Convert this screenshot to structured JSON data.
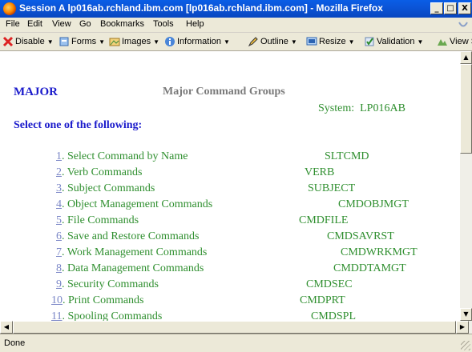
{
  "window": {
    "title": "Session A lp016ab.rchland.ibm.com [lp016ab.rchland.ibm.com] - Mozilla Firefox",
    "minimize": "_",
    "maximize": "□",
    "close": "X"
  },
  "menu": {
    "file": "File",
    "edit": "Edit",
    "view": "View",
    "go": "Go",
    "bookmarks": "Bookmarks",
    "tools": "Tools",
    "help": "Help"
  },
  "toolbar": {
    "disable": "Disable",
    "forms": "Forms",
    "images": "Images",
    "information": "Information",
    "outline": "Outline",
    "resize": "Resize",
    "validation": "Validation",
    "view_source": "View S"
  },
  "page": {
    "panel_id": "MAJOR",
    "panel_title": "Major Command Groups",
    "system_label": "System:",
    "system_name": "LP016AB",
    "prompt": "Select one of the following:",
    "options": [
      {
        "num": "1",
        "label": ". Select Command by Name",
        "command": "SLTCMD"
      },
      {
        "num": "2",
        "label": ". Verb Commands",
        "command": "VERB"
      },
      {
        "num": "3",
        "label": ". Subject Commands",
        "command": "SUBJECT"
      },
      {
        "num": "4",
        "label": ". Object Management Commands",
        "command": "CMDOBJMGT"
      },
      {
        "num": "5",
        "label": ". File Commands",
        "command": "CMDFILE"
      },
      {
        "num": "6",
        "label": ". Save and Restore Commands",
        "command": "CMDSAVRST"
      },
      {
        "num": "7",
        "label": ". Work Management Commands",
        "command": "CMDWRKMGT"
      },
      {
        "num": "8",
        "label": ". Data Management Commands",
        "command": "CMDDTAMGT"
      },
      {
        "num": "9",
        "label": ". Security Commands",
        "command": "CMDSEC"
      },
      {
        "num": "10",
        "label": ". Print Commands",
        "command": "CMDPRT"
      },
      {
        "num": "11",
        "label": ". Spooling Commands",
        "command": "CMDSPL"
      }
    ]
  },
  "status": {
    "text": "Done"
  },
  "colors": {
    "titlebar": "#0b55d8",
    "heading_blue": "#1a1acb",
    "text_green": "#2f8f2f",
    "link_num": "#7b87c7",
    "chrome": "#ece9d8"
  }
}
